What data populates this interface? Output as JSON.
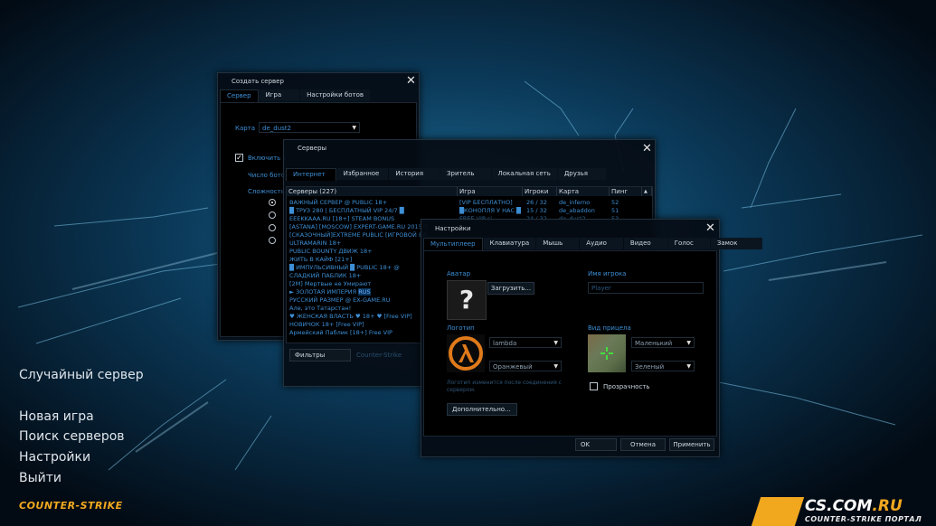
{
  "menu": {
    "quick_server": "Случайный сервер",
    "new_game": "Новая игра",
    "find_servers": "Поиск серверов",
    "settings": "Настройки",
    "quit": "Выйти"
  },
  "brand": {
    "logo": "COUNTER-STRIKE"
  },
  "site": {
    "name_main": "CS.COM",
    "name_tld": ".RU",
    "tagline": "COUNTER-STRIKE ПОРТАЛ"
  },
  "create_server": {
    "title": "Создать сервер",
    "tabs": [
      "Сервер",
      "Игра",
      "Настройки ботов"
    ],
    "map_label": "Карта",
    "map_value": "de_dust2",
    "enable_bots_label": "Включить б",
    "bot_count_label": "Число ботов",
    "difficulty_label": "Сложность"
  },
  "servers": {
    "title": "Серверы",
    "tabs": [
      "Интернет",
      "Избранное",
      "История",
      "Зритель",
      "Локальная сеть",
      "Друзья"
    ],
    "columns": {
      "name": "Серверы (227)",
      "game": "Игра",
      "players": "Игроки",
      "map": "Карта",
      "ping": "Пинг"
    },
    "rows": [
      {
        "name": "ВАЖНЫЙ СЕРВЕР @ PUBLIC 18+",
        "game": "[VIP БЕСПЛАТНО]",
        "players": "26 / 32",
        "map": "de_inferno",
        "ping": "52"
      },
      {
        "name": "█ ТРУЗ 280 | БЕСПЛАТНЫЙ VIP 24/7 █",
        "game": "█КОНОПЛЯ У НАС █",
        "players": "15 / 32",
        "map": "de_abaddon",
        "ping": "51"
      },
      {
        "name": "EEEKKAAA.RU [18+] STEAM BONUS",
        "game": "FREE VIP si",
        "players": "24 / 32",
        "map": "de_dust2",
        "ping": "53"
      },
      {
        "name": "[ASTANA] [MOSCOW] EXPERT-GAME.RU 2015-2"
      },
      {
        "name": "[СКАЗОЧНЫЙ]EXTREME PUBLIC [ИГРОВОЙ ВА"
      },
      {
        "name": "ULTRAMARIN 18+"
      },
      {
        "name": "PUBLIC BOUNTY ДВИЖ 18+"
      },
      {
        "name": "ЖИТЬ В КАЙФ [21+]"
      },
      {
        "name": "█ ИМПУЛЬСИВНЫЙ █ PUBLIC 18+ @"
      },
      {
        "name": "СЛАДКИЙ ПАБЛИК 18+"
      },
      {
        "name": "[2M] Мертвые не Умирают"
      },
      {
        "name": "► ЗОЛОТАЯ ИМПЕРИЯ",
        "tag": "RUS"
      },
      {
        "name": "РУССКИЙ РАЗМЕР @ EX-GAME.RU"
      },
      {
        "name": "Але, это Татарстан!"
      },
      {
        "name": "♥ ЖЕНСКАЯ ВЛАСТЬ ♥ 18+ ♥ [Free VIP]"
      },
      {
        "name": "НОВИЧОК 18+ [Free VIP]"
      },
      {
        "name": "Армейский Паблик [18+] Free VIP"
      }
    ],
    "filters_label": "Фильтры",
    "filter_game": "Counter-Strike"
  },
  "settings": {
    "title": "Настройки",
    "tabs": [
      "Мультиплеер",
      "Клавиатура",
      "Мышь",
      "Аудио",
      "Видео",
      "Голос",
      "Замок"
    ],
    "avatar_label": "Аватар",
    "avatar_placeholder": "?",
    "upload_button": "Загрузить...",
    "player_name_label": "Имя игрока",
    "player_name_value": "Player",
    "logo_label": "Логотип",
    "logo_value": "lambda",
    "logo_color": "Оранжевый",
    "logo_note": "Логотип изменится после соединения с сервером.",
    "crosshair_label": "Вид прицела",
    "crosshair_size": "Маленький",
    "crosshair_color": "Зеленый",
    "transparency_label": "Прозрачность",
    "advanced_button": "Дополнительно...",
    "ok_button": "OK",
    "cancel_button": "Отмена",
    "apply_button": "Применить"
  },
  "colors": {
    "accent": "#3d8fd6",
    "brand": "#f1a81f"
  }
}
